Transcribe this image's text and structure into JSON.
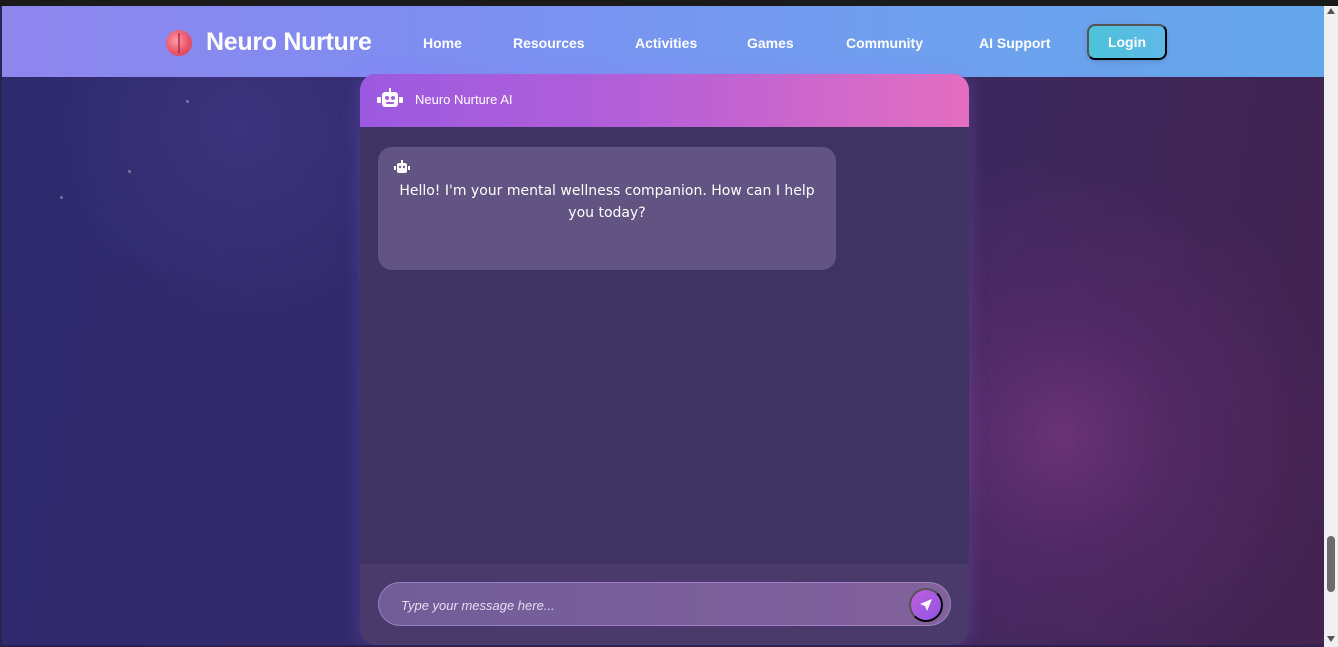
{
  "navbar": {
    "brand": "Neuro Nurture",
    "logo_icon": "brain-icon",
    "links": [
      "Home",
      "Resources",
      "Activities",
      "Games",
      "Community",
      "AI Support"
    ],
    "login_label": "Login"
  },
  "chat": {
    "header_title": "Neuro Nurture AI",
    "header_icon": "robot-icon",
    "messages": [
      {
        "sender": "bot",
        "icon": "robot-icon",
        "text": "Hello! I'm your mental wellness companion. How can I help you today?"
      }
    ],
    "input": {
      "placeholder": "Type your message here...",
      "value": ""
    },
    "send_icon": "paper-plane-icon"
  },
  "colors": {
    "navbar_start": "#8f86ee",
    "navbar_end": "#64a6ea",
    "chat_header_start": "#9c5ae0",
    "chat_header_end": "#e46ec0",
    "login_button": "#4cc3d8",
    "send_button": "#c25fe0"
  }
}
